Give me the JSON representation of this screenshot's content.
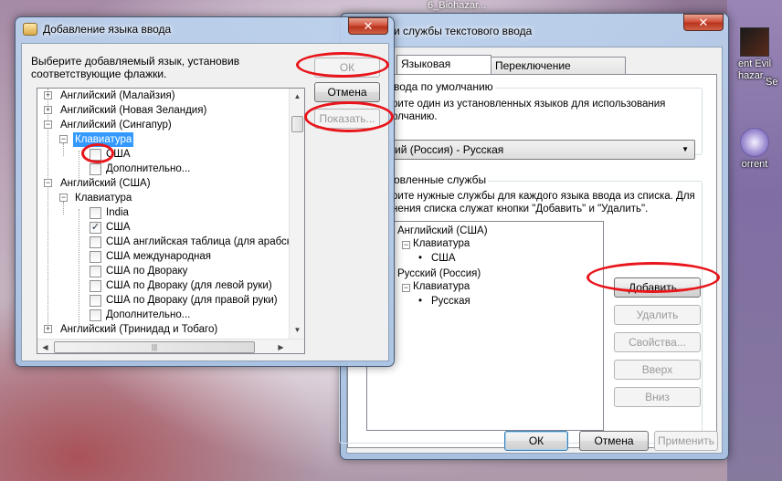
{
  "desktop": {
    "top_label": "6_Biohazar...",
    "icons": [
      {
        "label": "ent Evil\nhazar..."
      },
      {
        "label": "Se"
      },
      {
        "label": "orrent"
      }
    ]
  },
  "back_window": {
    "title": "и службы текстового ввода",
    "close_glyph": "✕",
    "tabs": [
      "Языковая панель",
      "Переключение клавиатуры"
    ],
    "default_lang_group": "вода по умолчанию",
    "default_lang_desc": "рите один из установленных языков для использования\nолчанию.",
    "default_lang_value": "ий (Россия) - Русская",
    "services_group": "овленные службы",
    "services_desc": "рите нужные службы для каждого языка ввода из списка. Для\nнения списка служат кнопки \"Добавить\" и \"Удалить\".",
    "services_tree": [
      {
        "text": "Английский (США)",
        "level": 0
      },
      {
        "text": "Клавиатура",
        "level": 1
      },
      {
        "text": "США",
        "level": 2
      },
      {
        "text": "Русский (Россия)",
        "level": 0
      },
      {
        "text": "Клавиатура",
        "level": 1
      },
      {
        "text": "Русская",
        "level": 2
      }
    ],
    "buttons": {
      "add": "Добавить...",
      "remove": "Удалить",
      "properties": "Свойства...",
      "up": "Вверх",
      "down": "Вниз",
      "ok": "ОК",
      "cancel": "Отмена",
      "apply": "Применить"
    }
  },
  "front_window": {
    "title": "Добавление языка ввода",
    "close_glyph": "✕",
    "instruction": "Выберите добавляемый язык, установив\nсоответствующие флажки.",
    "buttons": {
      "ok": "ОК",
      "cancel": "Отмена",
      "show": "Показать..."
    },
    "tree": [
      {
        "text": "Английский (Малайзия)",
        "kind": "lang",
        "expander": "+"
      },
      {
        "text": "Английский (Новая Зеландия)",
        "kind": "lang",
        "expander": "+"
      },
      {
        "text": "Английский (Сингапур)",
        "kind": "lang",
        "expander": "−"
      },
      {
        "text": "Клавиатура",
        "kind": "group",
        "expander": "−",
        "selected": true
      },
      {
        "text": "США",
        "kind": "item",
        "checked": false
      },
      {
        "text": "Дополнительно...",
        "kind": "item",
        "checked": false
      },
      {
        "text": "Английский (США)",
        "kind": "lang",
        "expander": "−"
      },
      {
        "text": "Клавиатура",
        "kind": "group",
        "expander": "−"
      },
      {
        "text": "India",
        "kind": "item",
        "checked": false
      },
      {
        "text": "США",
        "kind": "item",
        "checked": true
      },
      {
        "text": "США английская таблица (для арабской",
        "kind": "item",
        "checked": false
      },
      {
        "text": "США международная",
        "kind": "item",
        "checked": false
      },
      {
        "text": "США по Двораку",
        "kind": "item",
        "checked": false
      },
      {
        "text": "США по Двораку (для левой руки)",
        "kind": "item",
        "checked": false
      },
      {
        "text": "США по Двораку (для правой руки)",
        "kind": "item",
        "checked": false
      },
      {
        "text": "Дополнительно...",
        "kind": "item",
        "checked": false
      },
      {
        "text": "Английский (Тринидад и Тобаго)",
        "kind": "lang",
        "expander": "+"
      }
    ],
    "checkmark": "✓",
    "scroll_grip": "|||"
  },
  "colors": {
    "annotation_ring": "#e8151b",
    "selection": "#3399ff"
  }
}
